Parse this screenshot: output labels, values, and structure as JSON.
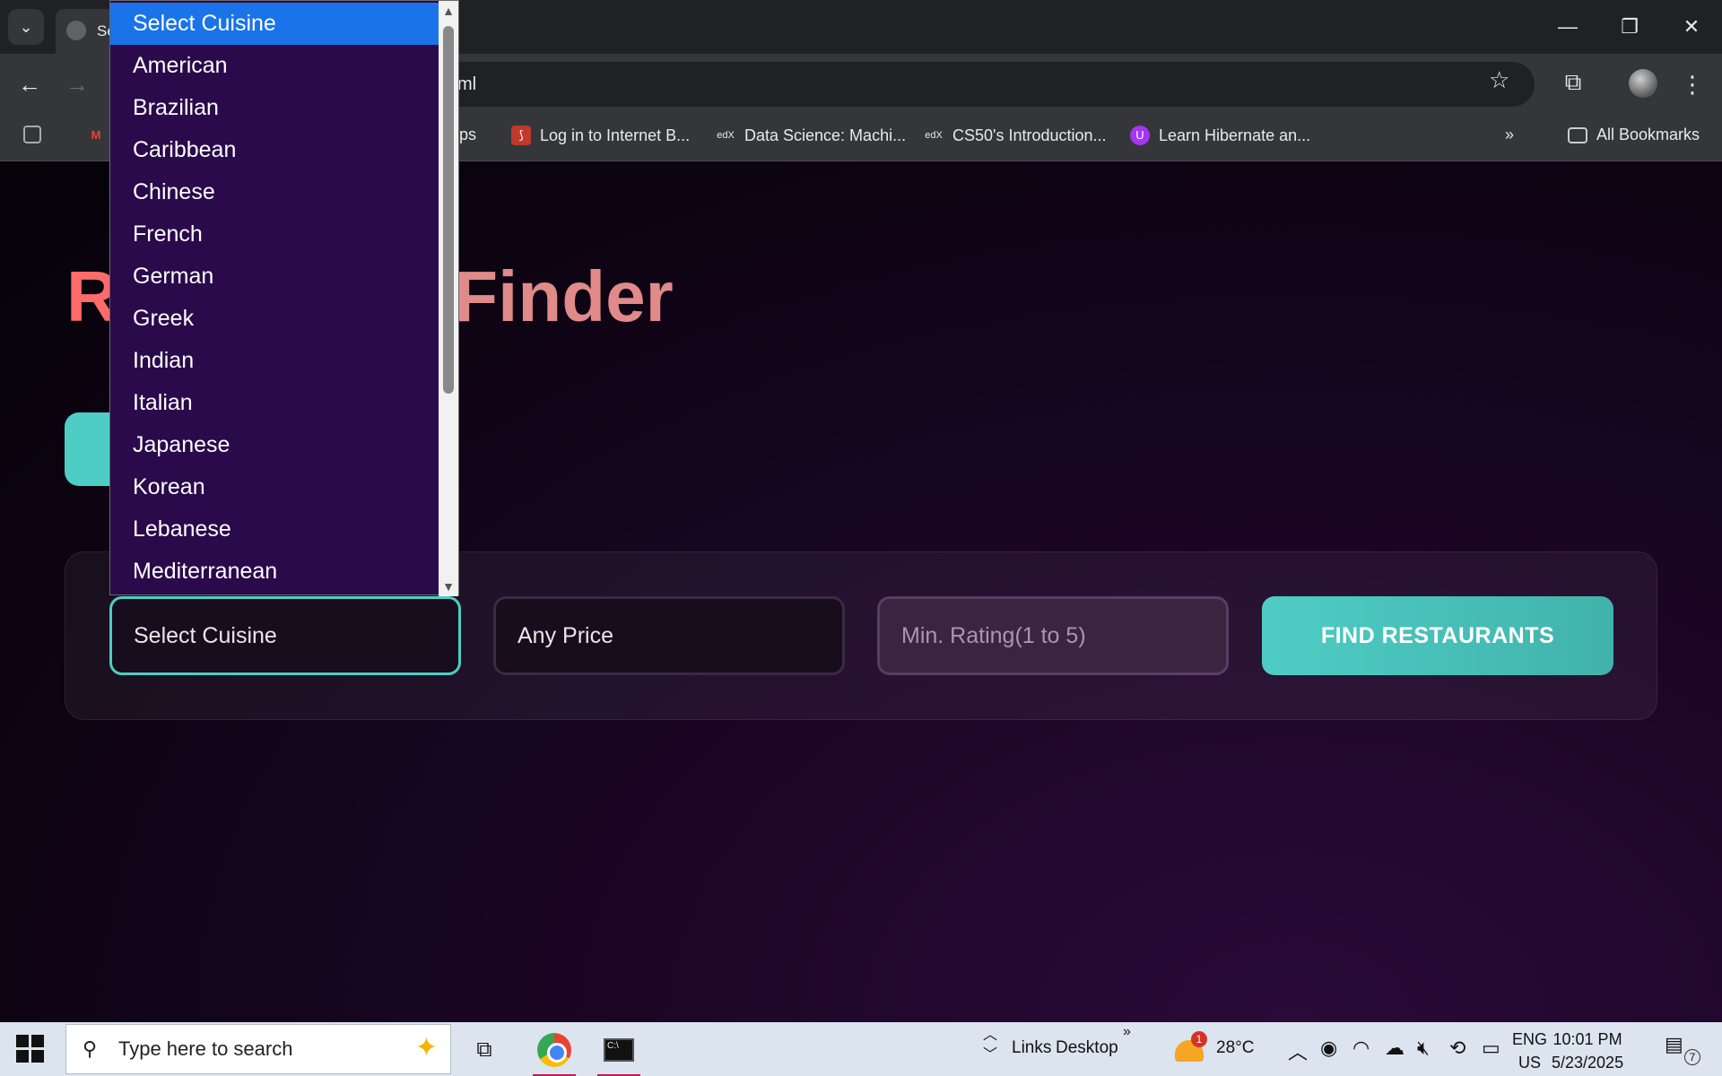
{
  "browser": {
    "tab_title": "Se",
    "address": "ml",
    "bookmarks": [
      {
        "label": "aps"
      },
      {
        "label": "Log in to Internet B..."
      },
      {
        "label": "Data Science: Machi..."
      },
      {
        "label": "CS50's Introduction..."
      },
      {
        "label": "Learn Hibernate an..."
      }
    ],
    "all_bookmarks": "All Bookmarks"
  },
  "page": {
    "title_part1": "R",
    "title_part2": "Finder",
    "form": {
      "cuisine_value": "Select Cuisine",
      "price_value": "Any Price",
      "rating_placeholder": "Min. Rating(1 to 5)",
      "submit_label": "FIND RESTAURANTS"
    }
  },
  "dropdown": {
    "options": [
      {
        "label": "Select Cuisine",
        "selected": true
      },
      {
        "label": "American"
      },
      {
        "label": "Brazilian"
      },
      {
        "label": "Caribbean"
      },
      {
        "label": "Chinese"
      },
      {
        "label": "French"
      },
      {
        "label": "German"
      },
      {
        "label": "Greek"
      },
      {
        "label": "Indian"
      },
      {
        "label": "Italian"
      },
      {
        "label": "Japanese"
      },
      {
        "label": "Korean"
      },
      {
        "label": "Lebanese"
      },
      {
        "label": "Mediterranean"
      }
    ]
  },
  "taskbar": {
    "search_placeholder": "Type here to search",
    "links": "Links",
    "desktop": "Desktop",
    "weather_badge": "1",
    "temperature": "28°C",
    "lang_top": "ENG",
    "lang_bottom": "US",
    "time": "10:01 PM",
    "date": "5/23/2025",
    "notification_count": "7"
  },
  "colors": {
    "accent_teal": "#4ecdc4",
    "title_coral": "#ff6b6b",
    "dropdown_bg": "#2a0a4a",
    "selected_blue": "#1a73e8"
  }
}
